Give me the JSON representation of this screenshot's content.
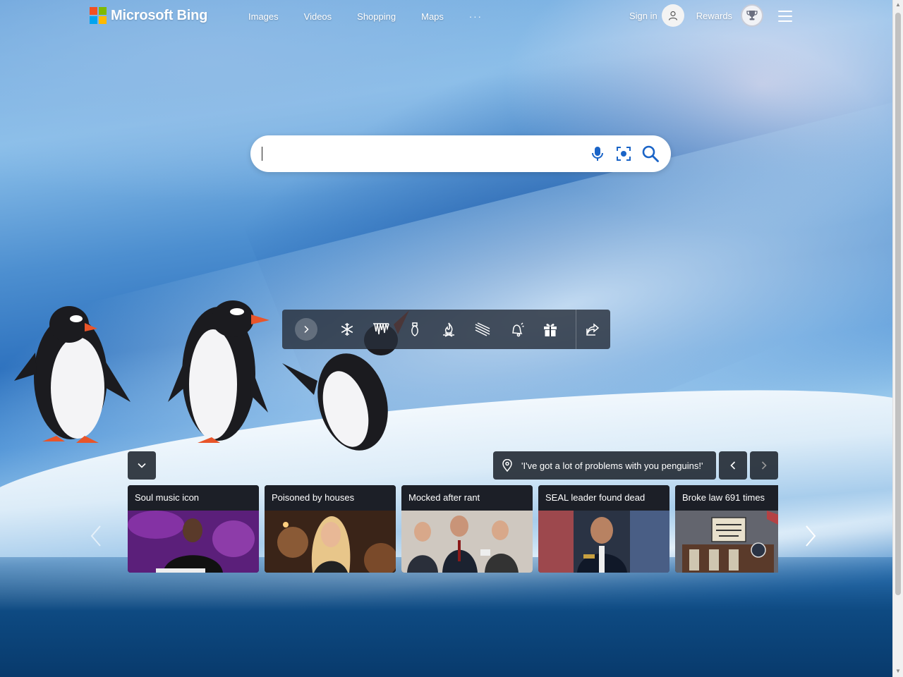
{
  "brand": {
    "name": "Microsoft Bing"
  },
  "nav": {
    "items": [
      "Images",
      "Videos",
      "Shopping",
      "Maps"
    ],
    "more": "···"
  },
  "header": {
    "signin": "Sign in",
    "rewards": "Rewards"
  },
  "search": {
    "value": "",
    "placeholder": ""
  },
  "image": {
    "caption": "'I've got a lot of problems with you penguins!'"
  },
  "news": [
    {
      "title": "Soul music icon"
    },
    {
      "title": "Poisoned by houses"
    },
    {
      "title": "Mocked after rant"
    },
    {
      "title": "SEAL leader found dead"
    },
    {
      "title": "Broke law 691 times"
    }
  ],
  "icons": {
    "toolbar": [
      "expand-chevron-icon",
      "snowflake-icon",
      "icicles-icon",
      "christmas-light-icon",
      "fire-icon",
      "sledding-icon",
      "bell-icon",
      "gift-icon",
      "share-icon"
    ]
  },
  "colors": {
    "accent": "#0078d4",
    "toolbar_bg": "#28303c"
  }
}
